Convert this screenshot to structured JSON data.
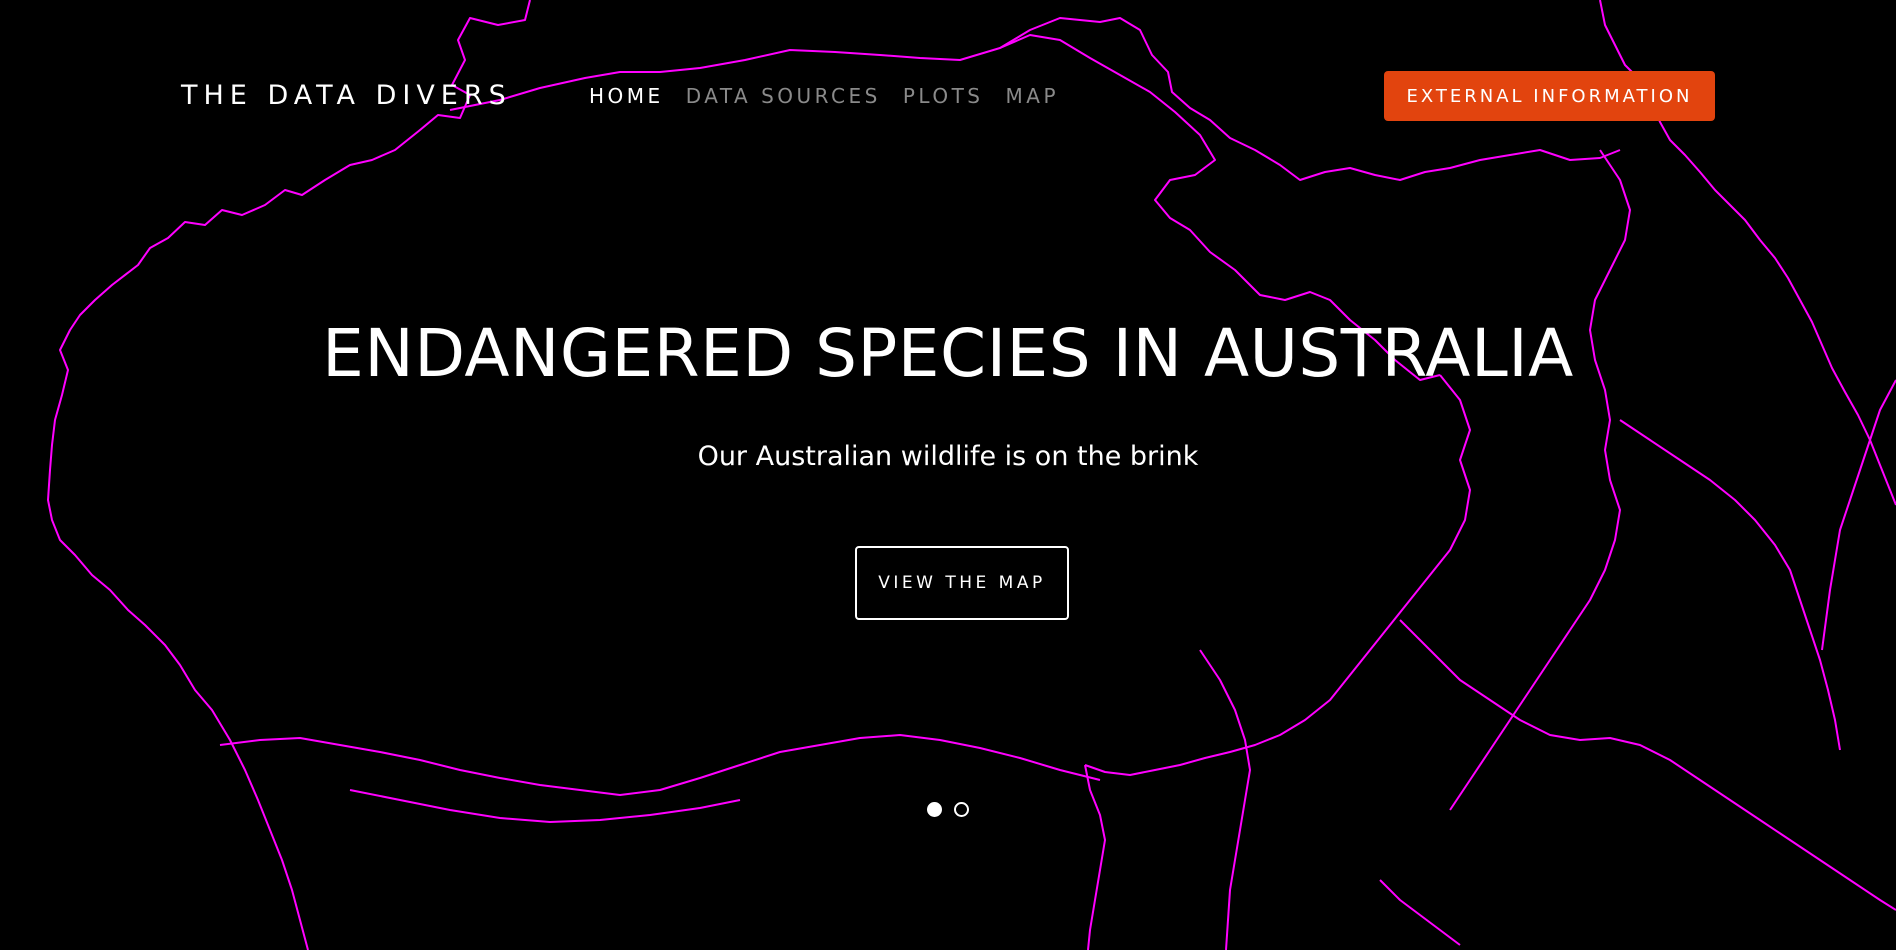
{
  "nav": {
    "brand": "THE DATA DIVERS",
    "links": [
      {
        "label": "HOME",
        "active": true
      },
      {
        "label": "DATA SOURCES",
        "active": false
      },
      {
        "label": "PLOTS",
        "active": false
      },
      {
        "label": "MAP",
        "active": false
      }
    ],
    "cta_label": "EXTERNAL INFORMATION"
  },
  "hero": {
    "title": "ENDANGERED SPECIES IN AUSTRALIA",
    "subtitle": "Our Australian wildlife is on the brink",
    "button_label": "VIEW THE MAP",
    "background_icon": "australia-outline-map",
    "slides": [
      {
        "active": true
      },
      {
        "active": false
      }
    ]
  },
  "colors": {
    "background": "#000000",
    "map_outline": "#ff00ff",
    "accent": "#e2440e",
    "text": "#ffffff",
    "nav_inactive": "#8a8a8a"
  }
}
